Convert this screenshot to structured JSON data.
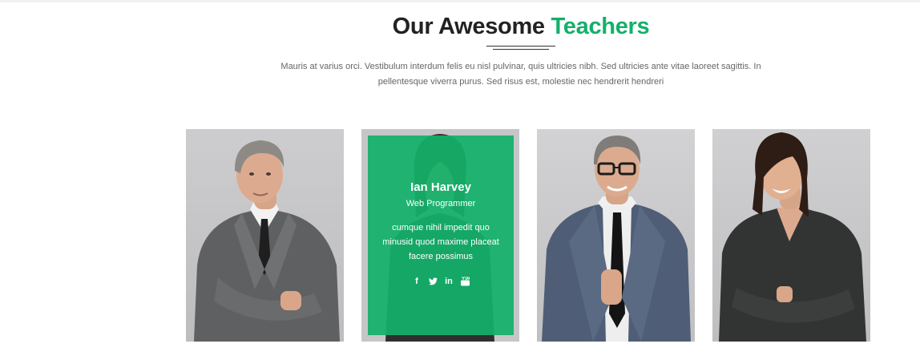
{
  "header": {
    "title_main": "Our Awesome",
    "title_accent": "Teachers",
    "subtitle": "Mauris at varius orci. Vestibulum interdum felis eu nisl pulvinar, quis ultricies nibh. Sed ultricies ante vitae laoreet sagittis. In pellentesque viverra purus. Sed risus est, molestie nec hendrerit hendreri"
  },
  "colors": {
    "accent": "#13b06a",
    "card_background": "#c9c9cb"
  },
  "teachers": [
    {
      "photo": "man-grey-suit-arms-crossed"
    },
    {
      "photo": "woman-smiling",
      "name": "Ian Harvey",
      "role": "Web Programmer",
      "bio": "cumque nihil impedit quo minusid quod maxime placeat facere possimus",
      "socials": [
        "facebook-icon",
        "twitter-icon",
        "linkedin-icon",
        "youtube-icon"
      ]
    },
    {
      "photo": "man-glasses-thumbs-up"
    },
    {
      "photo": "woman-black-blazer-arms-crossed"
    }
  ]
}
